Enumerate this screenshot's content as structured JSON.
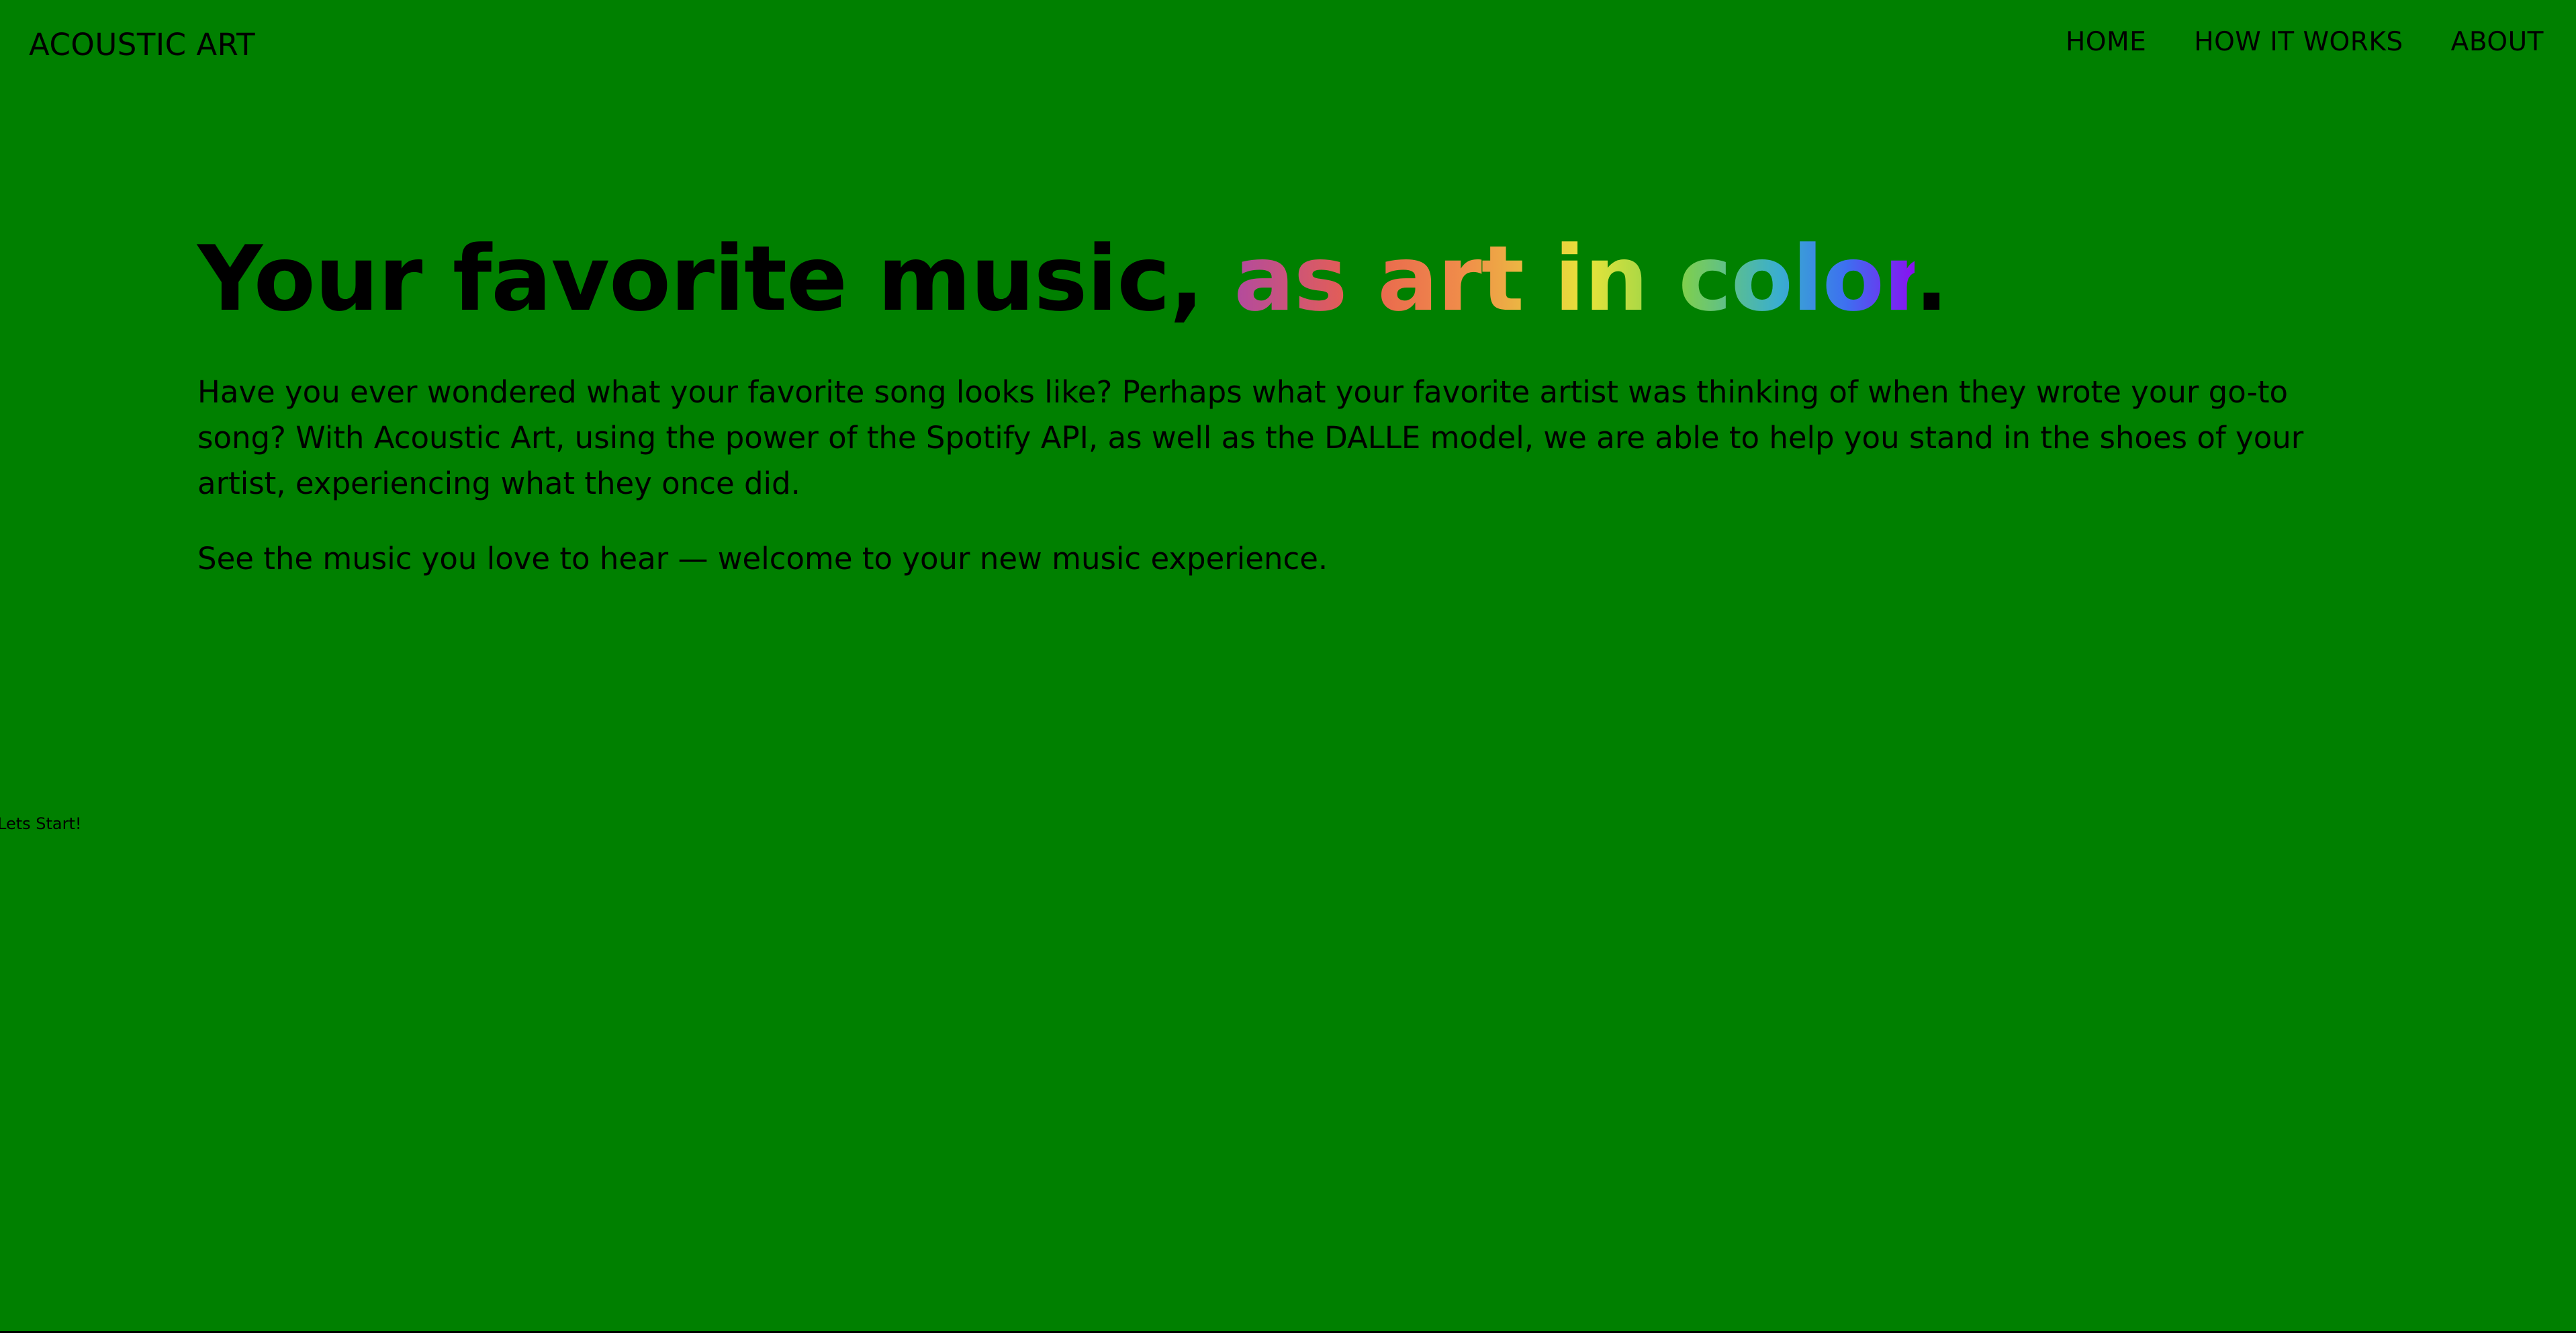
{
  "header": {
    "brand": "ACOUSTIC ART",
    "nav": [
      {
        "label": "HOME"
      },
      {
        "label": "HOW IT WORKS"
      },
      {
        "label": "ABOUT"
      }
    ]
  },
  "hero": {
    "headline_lead": "Your favorite music, ",
    "headline_highlight": "as art in color",
    "headline_end": ".",
    "paragraph1": "Have you ever wondered what your favorite song looks like? Perhaps what your favorite artist was thinking of when they wrote your go-to song? With Acoustic Art, using the power of the Spotify API, as well as the DALLE model, we are able to help you stand in the shoes of your artist, experiencing what they once did.",
    "paragraph2": "See the music you love to hear — welcome to your new music experience."
  },
  "cta": {
    "label": "Lets Start!"
  },
  "colors": {
    "background": "#008000",
    "text": "#000000",
    "gradient": [
      "#b24a9f",
      "#e8604f",
      "#f08e4a",
      "#e7e43a",
      "#7fcf4d",
      "#3aaecf",
      "#3d6ff0",
      "#8a10f0"
    ]
  }
}
